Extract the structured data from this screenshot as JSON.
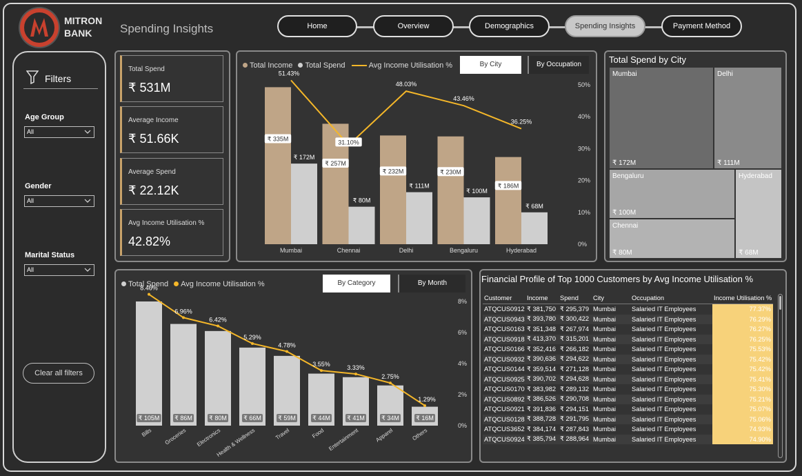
{
  "brand": {
    "line1": "MITRON",
    "line2": "BANK"
  },
  "page_title": "Spending Insights",
  "nav": [
    "Home",
    "Overview",
    "Demographics",
    "Spending Insights",
    "Payment Method"
  ],
  "filters": {
    "title": "Filters",
    "age": {
      "label": "Age Group",
      "value": "All"
    },
    "gender": {
      "label": "Gender",
      "value": "All"
    },
    "marital": {
      "label": "Marital Status",
      "value": "All"
    },
    "clear": "Clear all filters"
  },
  "kpis": [
    {
      "label": "Total Spend",
      "value": "₹ 531M"
    },
    {
      "label": "Average Income",
      "value": "₹ 51.66K"
    },
    {
      "label": "Average Spend",
      "value": "₹ 22.12K"
    },
    {
      "label": "Avg Income Utilisation %",
      "value": "42.82%"
    }
  ],
  "city_chart": {
    "legend": {
      "income": "Total Income",
      "spend": "Total Spend",
      "util": "Avg Income Utilisation %"
    },
    "tabs": [
      "By City",
      "By Occupation"
    ]
  },
  "cat_chart": {
    "legend": {
      "spend": "Total Spend",
      "util": "Avg Income Utilisation %"
    },
    "tabs": [
      "By Category",
      "By Month"
    ]
  },
  "treemap": {
    "title": "Total Spend by City",
    "cells": [
      {
        "name": "Mumbai",
        "value": "₹ 172M"
      },
      {
        "name": "Delhi",
        "value": "₹ 111M"
      },
      {
        "name": "Bengaluru",
        "value": "₹ 100M"
      },
      {
        "name": "Hyderabad",
        "value": "₹ 68M"
      },
      {
        "name": "Chennai",
        "value": "₹ 80M"
      }
    ]
  },
  "table": {
    "title": "Financial Profile of Top 1000 Customers by Avg Income Utilisation %",
    "headers": [
      "Customer",
      "Income",
      "Spend",
      "City",
      "Occupation",
      "Income Utilisation %"
    ],
    "rows": [
      [
        "ATQCUS0912",
        "₹ 381,750",
        "₹ 295,379",
        "Mumbai",
        "Salaried IT Employees",
        "77.37%"
      ],
      [
        "ATQCUS0943",
        "₹ 393,780",
        "₹ 300,422",
        "Mumbai",
        "Salaried IT Employees",
        "76.29%"
      ],
      [
        "ATQCUS0163",
        "₹ 351,348",
        "₹ 267,974",
        "Mumbai",
        "Salaried IT Employees",
        "76.27%"
      ],
      [
        "ATQCUS0918",
        "₹ 413,370",
        "₹ 315,201",
        "Mumbai",
        "Salaried IT Employees",
        "76.25%"
      ],
      [
        "ATQCUS0166",
        "₹ 352,416",
        "₹ 266,182",
        "Mumbai",
        "Salaried IT Employees",
        "75.53%"
      ],
      [
        "ATQCUS0932",
        "₹ 390,636",
        "₹ 294,622",
        "Mumbai",
        "Salaried IT Employees",
        "75.42%"
      ],
      [
        "ATQCUS0144",
        "₹ 359,514",
        "₹ 271,128",
        "Mumbai",
        "Salaried IT Employees",
        "75.42%"
      ],
      [
        "ATQCUS0925",
        "₹ 390,702",
        "₹ 294,628",
        "Mumbai",
        "Salaried IT Employees",
        "75.41%"
      ],
      [
        "ATQCUS0170",
        "₹ 383,982",
        "₹ 289,132",
        "Mumbai",
        "Salaried IT Employees",
        "75.30%"
      ],
      [
        "ATQCUS0892",
        "₹ 386,526",
        "₹ 290,708",
        "Mumbai",
        "Salaried IT Employees",
        "75.21%"
      ],
      [
        "ATQCUS0921",
        "₹ 391,836",
        "₹ 294,151",
        "Mumbai",
        "Salaried IT Employees",
        "75.07%"
      ],
      [
        "ATQCUS0128",
        "₹ 388,728",
        "₹ 291,795",
        "Mumbai",
        "Salaried IT Employees",
        "75.06%"
      ],
      [
        "ATQCUS3652",
        "₹ 384,174",
        "₹ 287,843",
        "Mumbai",
        "Salaried IT Employees",
        "74.93%"
      ],
      [
        "ATQCUS0924",
        "₹ 385,794",
        "₹ 288,964",
        "Mumbai",
        "Salaried IT Employees",
        "74.90%"
      ]
    ]
  },
  "chart_data": [
    {
      "type": "bar",
      "categories": [
        "Mumbai",
        "Chennai",
        "Delhi",
        "Bengaluru",
        "Hyderabad"
      ],
      "series": [
        {
          "name": "Total Income",
          "values": [
            335,
            257,
            232,
            230,
            186
          ],
          "labels": [
            "₹ 335M",
            "₹ 257M",
            "₹ 232M",
            "₹ 230M",
            "₹ 186M"
          ]
        },
        {
          "name": "Total Spend",
          "values": [
            172,
            80,
            111,
            100,
            68
          ],
          "labels": [
            "₹ 172M",
            "₹ 80M",
            "₹ 111M",
            "₹ 100M",
            "₹ 68M"
          ]
        },
        {
          "name": "Avg Income Utilisation %",
          "axis": "secondary",
          "type": "line",
          "values": [
            51.43,
            31.1,
            48.03,
            43.46,
            36.25
          ],
          "labels": [
            "51.43%",
            "31.10%",
            "48.03%",
            "43.46%",
            "36.25%"
          ]
        }
      ],
      "ylim": [
        0,
        340
      ],
      "y2lim": [
        0,
        50
      ],
      "y2ticks": [
        "0%",
        "10%",
        "20%",
        "30%",
        "40%",
        "50%"
      ],
      "colors": {
        "income": "#bfa587",
        "spend": "#cfcfcf",
        "util": "#f5b729"
      }
    },
    {
      "type": "bar",
      "categories": [
        "Bills",
        "Groceries",
        "Electronics",
        "Health & Wellness",
        "Travel",
        "Food",
        "Entertainment",
        "Apparel",
        "Others"
      ],
      "series": [
        {
          "name": "Total Spend",
          "values": [
            105,
            86,
            80,
            66,
            59,
            44,
            41,
            34,
            16
          ],
          "labels": [
            "₹ 105M",
            "₹ 86M",
            "₹ 80M",
            "₹ 66M",
            "₹ 59M",
            "₹ 44M",
            "₹ 41M",
            "₹ 34M",
            "₹ 16M"
          ]
        },
        {
          "name": "Avg Income Utilisation %",
          "axis": "secondary",
          "type": "line",
          "values": [
            8.46,
            6.96,
            6.42,
            5.29,
            4.78,
            3.55,
            3.33,
            2.75,
            1.29
          ],
          "labels": [
            "8.46%",
            "6.96%",
            "6.42%",
            "5.29%",
            "4.78%",
            "3.55%",
            "3.33%",
            "2.75%",
            "1.29%"
          ]
        }
      ],
      "ylim": [
        0,
        105
      ],
      "y2lim": [
        0,
        8
      ],
      "y2ticks": [
        "0%",
        "2%",
        "4%",
        "6%",
        "8%"
      ],
      "colors": {
        "spend": "#d0d0d0",
        "util": "#f5b729"
      }
    }
  ]
}
